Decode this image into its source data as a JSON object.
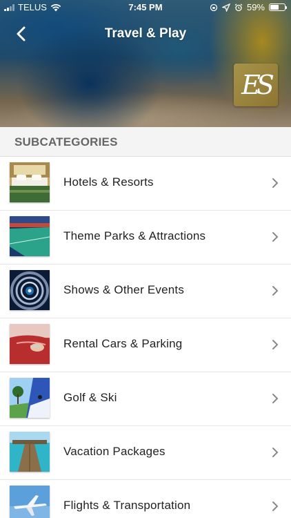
{
  "status_bar": {
    "carrier": "TELUS",
    "time": "7:45 PM",
    "battery": "59%",
    "battery_level": 0.59
  },
  "header": {
    "title": "Travel & Play",
    "logo_text": "ES"
  },
  "section": {
    "title": "SUBCATEGORIES"
  },
  "subcategories": [
    {
      "label": "Hotels & Resorts",
      "thumb": "hotel-room-thumbnail"
    },
    {
      "label": "Theme Parks & Attractions",
      "thumb": "arena-thumbnail"
    },
    {
      "label": "Shows & Other Events",
      "thumb": "spiral-staircase-thumbnail"
    },
    {
      "label": "Rental Cars & Parking",
      "thumb": "car-door-thumbnail"
    },
    {
      "label": "Golf & Ski",
      "thumb": "golf-ski-thumbnail"
    },
    {
      "label": "Vacation Packages",
      "thumb": "pier-thumbnail"
    },
    {
      "label": "Flights & Transportation",
      "thumb": "airplane-thumbnail"
    }
  ],
  "icons": {
    "back": "chevron-left-icon",
    "row_arrow": "chevron-right-icon"
  }
}
